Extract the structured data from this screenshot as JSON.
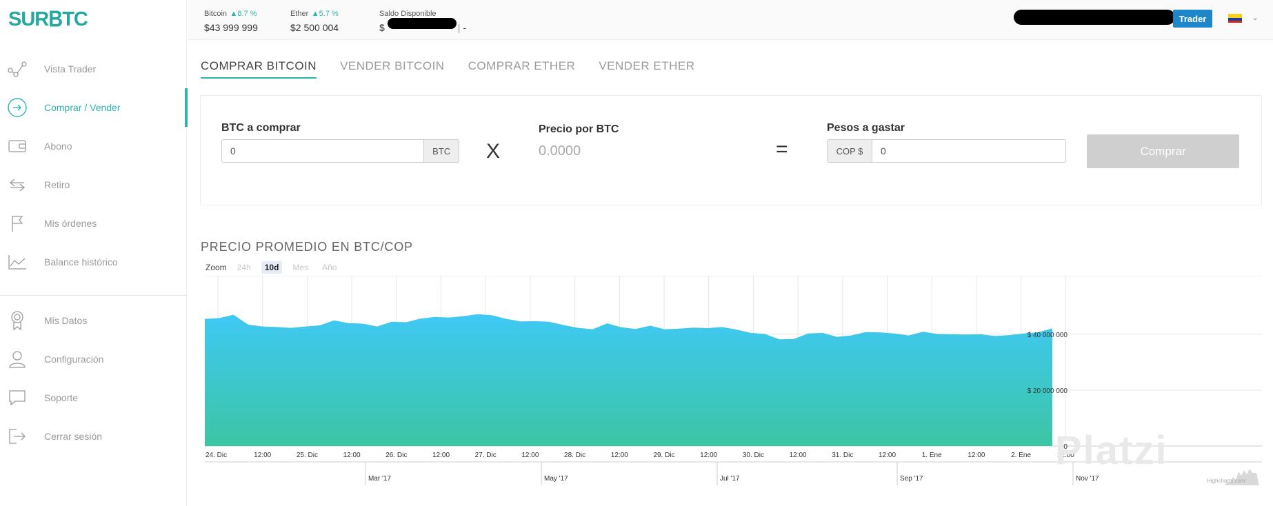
{
  "brand": {
    "logo_text_a": "SUR",
    "logo_text_b": "B",
    "logo_text_c": "TC"
  },
  "sidebar": {
    "items": [
      {
        "label": "Vista Trader",
        "icon": "graph-nodes-icon",
        "active": false
      },
      {
        "label": "Comprar / Vender",
        "icon": "arrow-circle-icon",
        "active": true
      },
      {
        "label": "Abono",
        "icon": "wallet-icon",
        "active": false
      },
      {
        "label": "Retiro",
        "icon": "transfer-arrows-icon",
        "active": false
      },
      {
        "label": "Mis órdenes",
        "icon": "flag-icon",
        "active": false
      },
      {
        "label": "Balance histórico",
        "icon": "line-chart-icon",
        "active": false
      }
    ],
    "secondary": [
      {
        "label": "Mis Datos",
        "icon": "badge-icon"
      },
      {
        "label": "Configuración",
        "icon": "user-icon"
      },
      {
        "label": "Soporte",
        "icon": "chat-bubble-icon"
      },
      {
        "label": "Cerrar sesión",
        "icon": "logout-icon"
      }
    ]
  },
  "topbar": {
    "bitcoin": {
      "name": "Bitcoin",
      "pct": "8.7 %",
      "value": "$43 999 999"
    },
    "ether": {
      "name": "Ether",
      "pct": "5.7 %",
      "value": "$2 500 004"
    },
    "saldo": {
      "name": "Saldo Disponible",
      "value_prefix": "$",
      "value_suffix": "-"
    },
    "trader_button": "Trader",
    "colors": {
      "up": "#2ab6ac",
      "trader": "#1f87c9"
    }
  },
  "tabs": [
    "COMPRAR BITCOIN",
    "VENDER BITCOIN",
    "COMPRAR ETHER",
    "VENDER ETHER"
  ],
  "form": {
    "btc_label": "BTC a comprar",
    "btc_value": "0",
    "btc_addon": "BTC",
    "times_symbol": "X",
    "price_label": "Precio por BTC",
    "price_value": "0.0000",
    "equals_symbol": "=",
    "pesos_label": "Pesos a gastar",
    "pesos_addon": "COP $",
    "pesos_value": "0",
    "submit": "Comprar"
  },
  "chart_section": {
    "title": "PRECIO PROMEDIO EN BTC/COP",
    "zoom_label": "Zoom",
    "zoom_options": [
      "24h",
      "10d",
      "Mes",
      "Año"
    ],
    "zoom_selected": "10d",
    "credit": "Highcharts.com"
  },
  "watermark": "Platzi",
  "chart_data": {
    "type": "area",
    "title": "PRECIO PROMEDIO EN BTC/COP",
    "x_ticks": [
      "24. Dic",
      "12:00",
      "25. Dic",
      "12:00",
      "26. Dic",
      "12:00",
      "27. Dic",
      "12:00",
      "28. Dic",
      "12:00",
      "29. Dic",
      "12:00",
      "30. Dic",
      "12:00",
      "31. Dic",
      "12:00",
      "1. Ene",
      "12:00",
      "2. Ene",
      "12:00"
    ],
    "y_ticks": [
      "$ 0",
      "$ 20 000 000",
      "$ 40 000 000"
    ],
    "ylim": [
      0,
      58000000
    ],
    "navigator_ticks": [
      "Mar '17",
      "May '17",
      "Jul '17",
      "Sep '17",
      "Nov '17"
    ],
    "series": [
      {
        "values": [
          45500000,
          45800000,
          47000000,
          43500000,
          42800000,
          42600000,
          42300000,
          42800000,
          43200000,
          45000000,
          44000000,
          43800000,
          42800000,
          44500000,
          44300000,
          45600000,
          46200000,
          46000000,
          46500000,
          47200000,
          46800000,
          45500000,
          44600000,
          44700000,
          44500000,
          43300000,
          42300000,
          41800000,
          43900000,
          42500000,
          41900000,
          43100000,
          41800000,
          42000000,
          42400000,
          42200000,
          42600000,
          41700000,
          40500000,
          40100000,
          38200000,
          38300000,
          40300000,
          40500000,
          39100000,
          39600000,
          40800000,
          40700000,
          40300000,
          39600000,
          40900000,
          40100000,
          40000000,
          39900000,
          40000000,
          39400000,
          39700000,
          40300000,
          40700000,
          42100000
        ]
      }
    ],
    "colors": {
      "top": "#3fc8f5",
      "bottom": "#3cc6a3"
    }
  }
}
